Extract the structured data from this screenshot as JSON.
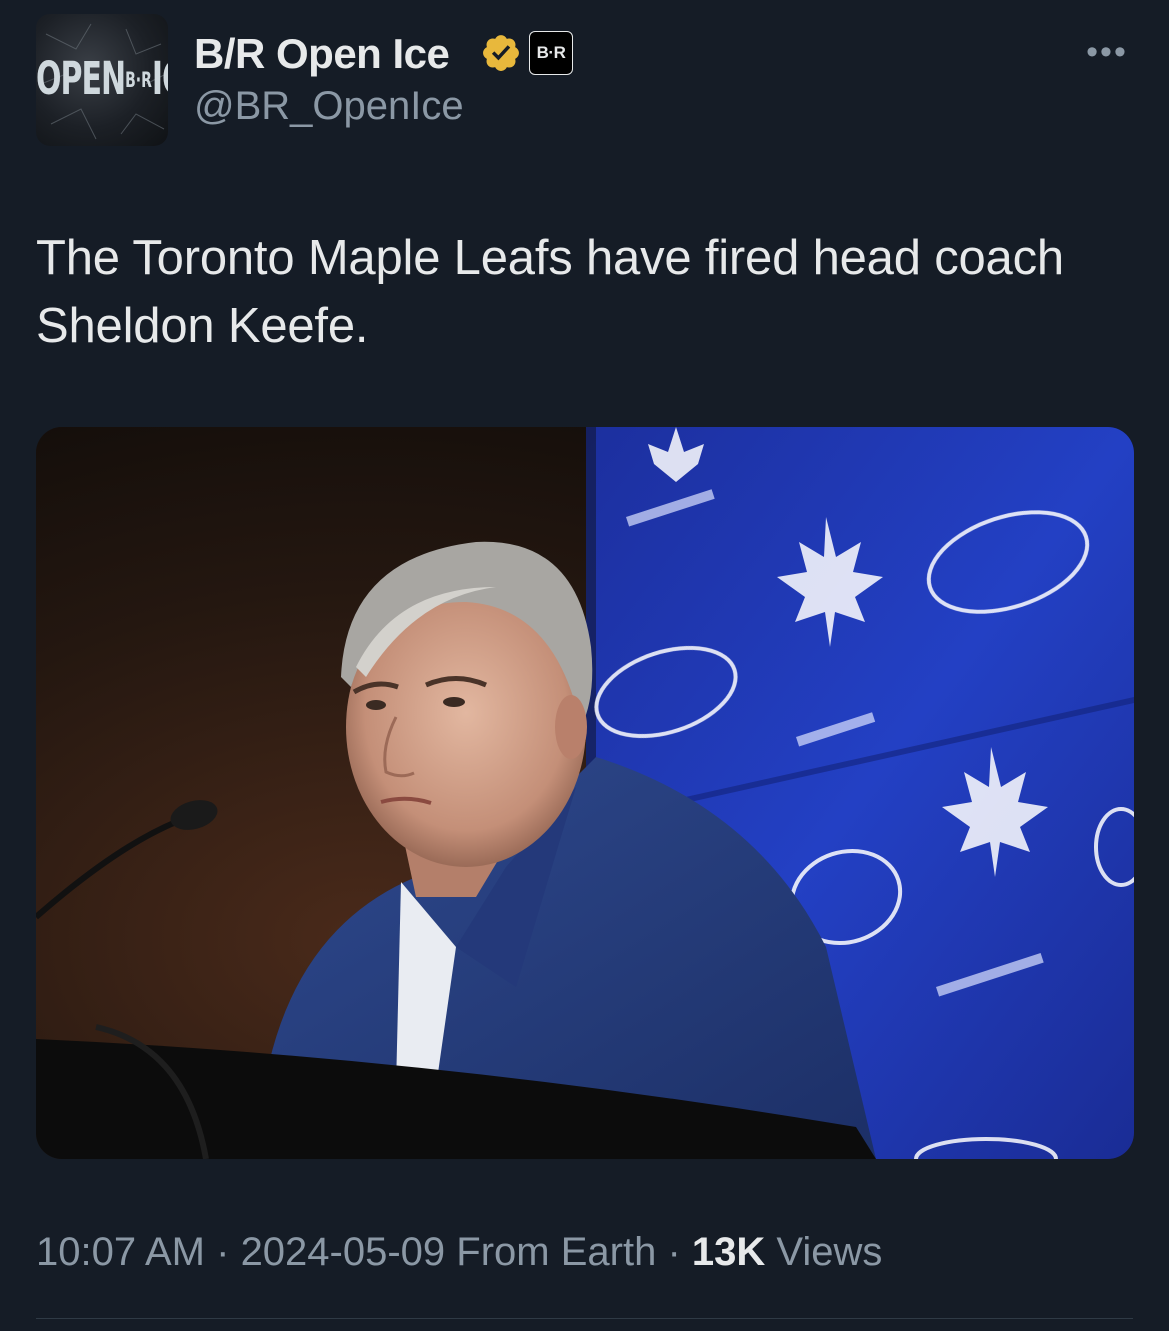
{
  "author": {
    "display_name": "B/R Open Ice",
    "handle": "@BR_OpenIce",
    "avatar_text_left": "OPEN",
    "avatar_text_mid": "B·R",
    "avatar_text_right": "ICE",
    "org_badge": "B·R",
    "verified_color": "#e8b83c"
  },
  "more_icon": "more-horizontal-icon",
  "tweet": {
    "text": "The Toronto Maple Leafs have fired head coach Sheldon Keefe.",
    "time": "10:07 AM",
    "sep1": " · ",
    "date": "2024-05-09",
    "source": " From Earth",
    "sep2": " · ",
    "views_count": "13K",
    "views_label": " Views"
  },
  "colors": {
    "background": "#151c26",
    "text": "#e7e9ea",
    "secondary": "#8b98a5",
    "backdrop_blue": "#1f33a8"
  }
}
